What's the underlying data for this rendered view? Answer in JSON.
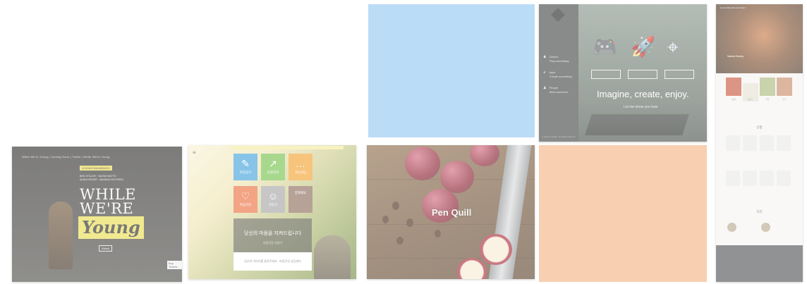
{
  "tiles": {
    "t1": {
      "nav": "While We're Young  |  Coming Soon  |  Trailer  |  While We're Young",
      "badge": "A NOAH BAUMBACH FILM",
      "blurb": "BEN STILLER · NAOMI WATTS · ADAM DRIVER · AMANDA SEYFRIED",
      "title_line1": "WHILE",
      "title_line2": "WE'RE",
      "title_line3": "Young",
      "button": "Watch",
      "button2": "Buy Tickets"
    },
    "t2": {
      "menu_glyph": "≡",
      "banner": "",
      "squares": [
        {
          "label": "마음일기",
          "icon": "note-icon",
          "glyph": "✎",
          "color": "#3fa1da"
        },
        {
          "label": "감정일지",
          "icon": "chart-icon",
          "glyph": "↗",
          "color": "#71c14a"
        },
        {
          "label": "고민상담",
          "icon": "chat-icon",
          "glyph": "…",
          "color": "#f3a12d"
        },
        {
          "label": "마음건강",
          "icon": "heart-icon",
          "glyph": "♡",
          "color": "#ea6d3a"
        },
        {
          "label": "전문가",
          "icon": "person-icon",
          "glyph": "☺",
          "color": "#a4a4a4"
        },
        {
          "label": "함께해요",
          "icon": "photo-icon",
          "glyph": "",
          "color": "#8a6a58"
        }
      ],
      "box_heading": "당신의 마음을 지켜드립니다",
      "box_sub": "마음건강 지킴이",
      "bar_text": "당신의 이야기를 들려주세요 · 마음건강 상담센터"
    },
    "t3": {
      "logo": "Pen Quill"
    },
    "t4": {
      "color": "#bbdcf7"
    },
    "t5": {
      "side_items": [
        {
          "icon": "gamepad-icon",
          "glyph": "♞",
          "title": "Games",
          "sub": "Play something"
        },
        {
          "icon": "rocket-icon",
          "glyph": "➶",
          "title": "Apps",
          "sub": "Create something"
        },
        {
          "icon": "user-icon",
          "glyph": "♟",
          "title": "People",
          "sub": "Meet someone"
        }
      ],
      "big_icons": [
        "🎮",
        "🚀",
        "⌖"
      ],
      "pills": [
        "",
        "",
        ""
      ],
      "tagline": "Imagine, create, enjoy.",
      "subline": "Let me show you how",
      "copyright": "© Design Studio. All rights reserved."
    },
    "t6": {
      "color": "#f8cfb0"
    },
    "t7": {
      "nav": "Home  Shop  About  Contact",
      "hero_text": "Natural Beauty",
      "section1": "상품",
      "section2": "리뷰",
      "captions": [
        "신상품",
        "베스트",
        "추천",
        "인기"
      ]
    }
  }
}
